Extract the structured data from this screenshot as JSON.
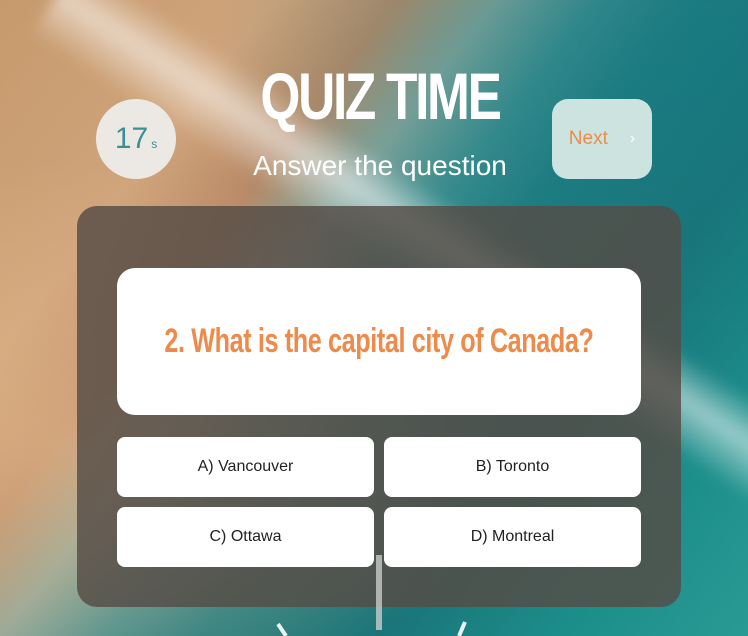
{
  "header": {
    "title": "QUIZ TIME",
    "subtitle": "Answer the question"
  },
  "timer": {
    "value": "17",
    "unit": "s"
  },
  "next_button": {
    "label": "Next",
    "icon": "chevron-right-icon"
  },
  "question": {
    "text": "2. What is the capital city of Canada?"
  },
  "answers": [
    {
      "label": "A) Vancouver"
    },
    {
      "label": "B) Toronto"
    },
    {
      "label": "C) Ottawa"
    },
    {
      "label": "D) Montreal"
    }
  ],
  "colors": {
    "accent": "#ee8a4a",
    "timer_text": "#3d8f94",
    "next_bg": "#cde3df",
    "panel": "#554c46"
  }
}
